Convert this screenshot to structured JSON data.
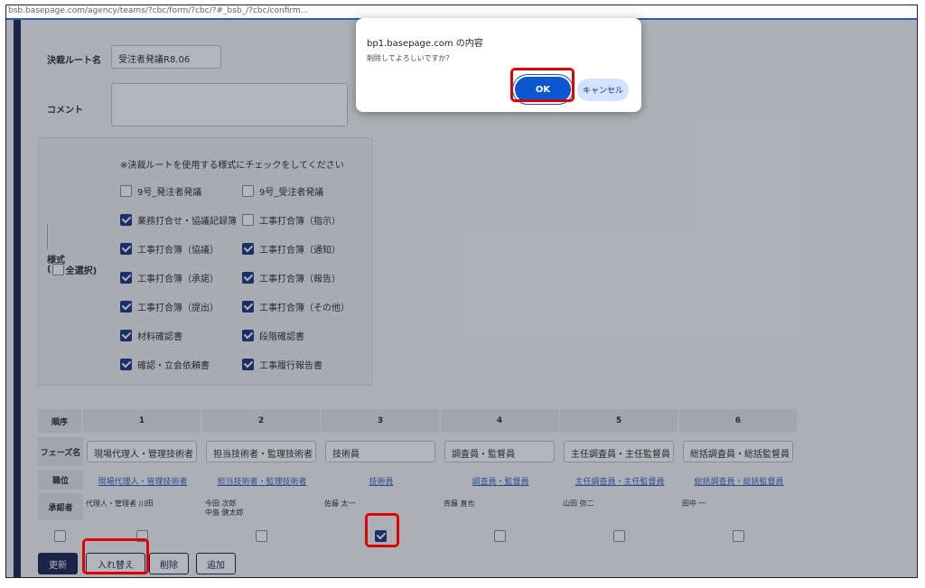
{
  "browser": {
    "url_fragment": "bsb.basepage.com/agency/teams/?cbc/form/?cbc/?#_bsb_/?cbc/confirm..."
  },
  "form": {
    "route_name_label": "決裁ルート名",
    "route_name_value": "受注者発議R8.06",
    "comment_label": "コメント",
    "format_label": "様式",
    "select_all_label": "全選択)",
    "select_all_paren": "(",
    "note": "※決裁ルートを使用する様式にチェックをしてください",
    "checkboxes": [
      {
        "label": "9号_発注者発議",
        "checked": false
      },
      {
        "label": "9号_受注者発議",
        "checked": false
      },
      {
        "label": "業務打合せ・協議記録簿",
        "checked": true
      },
      {
        "label": "工事打合簿（指示）",
        "checked": false
      },
      {
        "label": "工事打合簿（協議）",
        "checked": true
      },
      {
        "label": "工事打合簿（通知）",
        "checked": true
      },
      {
        "label": "工事打合簿（承諾）",
        "checked": true
      },
      {
        "label": "工事打合簿（報告）",
        "checked": true
      },
      {
        "label": "工事打合簿（提出）",
        "checked": true
      },
      {
        "label": "工事打合簿（その他）",
        "checked": true
      },
      {
        "label": "材料確認書",
        "checked": true
      },
      {
        "label": "段階確認書",
        "checked": true
      },
      {
        "label": "確認・立会依頼書",
        "checked": true
      },
      {
        "label": "工事履行報告書",
        "checked": true
      }
    ]
  },
  "table": {
    "order_label": "順序",
    "phase_label": "フェーズ名",
    "role_label": "職位",
    "approver_label": "承認者",
    "columns": [
      {
        "order": "1",
        "phase": "現場代理人・管理技術者",
        "role": "現場代理人・管理技術者",
        "approver": "代理人・管理者 川田",
        "approver2": "",
        "checked": false
      },
      {
        "order": "2",
        "phase": "担当技術者・監理技術者",
        "role": "担当技術者・監理技術者",
        "approver": "今田 次郎",
        "approver2": "中島 健太郎",
        "checked": false
      },
      {
        "order": "3",
        "phase": "技術員",
        "role": "技術員",
        "approver": "佐藤 太一",
        "approver2": "",
        "checked": true
      },
      {
        "order": "4",
        "phase": "調査員・監督員",
        "role": "調査員・監督員",
        "approver": "斉藤 直也",
        "approver2": "",
        "checked": false
      },
      {
        "order": "5",
        "phase": "主任調査員・主任監督員",
        "role": "主任調査員・主任監督員",
        "approver": "山田 弥二",
        "approver2": "",
        "checked": false
      },
      {
        "order": "6",
        "phase": "総括調査員・総括監督員",
        "role": "総括調査員・総括監督員",
        "approver": "田中 一",
        "approver2": "",
        "checked": false
      }
    ]
  },
  "actions": {
    "update": "更新",
    "swap": "入れ替え",
    "delete": "削除",
    "add": "追加"
  },
  "dialog": {
    "title": "bp1.basepage.com の内容",
    "message": "削除してよろしいですか？",
    "ok": "OK",
    "cancel": "キャンセル"
  },
  "colors": {
    "navy": "#1d2a55",
    "dialog_primary": "#0b57d0",
    "highlight": "#e00000"
  }
}
